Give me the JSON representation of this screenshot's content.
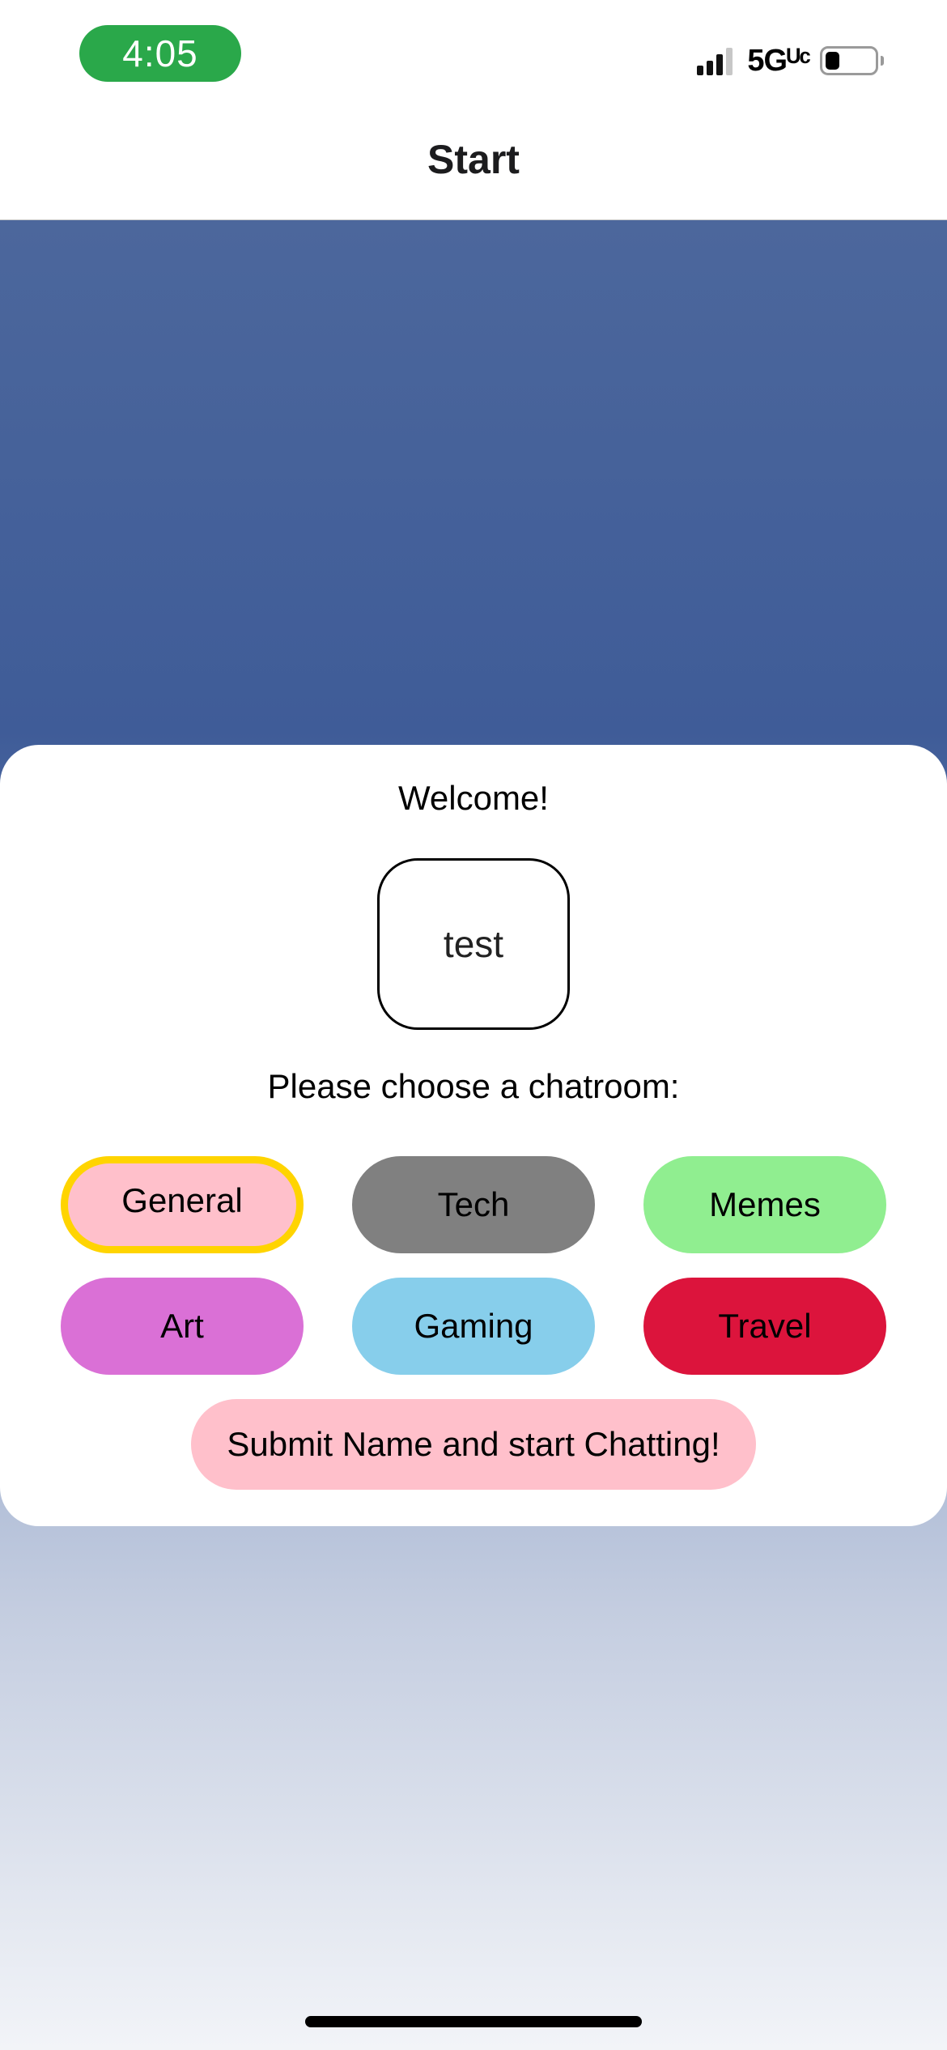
{
  "status_bar": {
    "time": "4:05",
    "time_pill_color": "#2aa84a",
    "network": "5Gᵁᶜ",
    "signal_icon": "cellular-signal-icon",
    "battery_icon": "battery-icon",
    "battery_level": 0.3
  },
  "header": {
    "title": "Start"
  },
  "card": {
    "welcome": "Welcome!",
    "name_input_value": "test",
    "prompt": "Please choose a chatroom:",
    "rooms": [
      {
        "label": "General",
        "color": "#ffc0cb",
        "selected": true
      },
      {
        "label": "Tech",
        "color": "#808080",
        "selected": false
      },
      {
        "label": "Memes",
        "color": "#90ee90",
        "selected": false
      },
      {
        "label": "Art",
        "color": "#da70d6",
        "selected": false
      },
      {
        "label": "Gaming",
        "color": "#87ceeb",
        "selected": false
      },
      {
        "label": "Travel",
        "color": "#dc143c",
        "selected": false
      }
    ],
    "selected_border_color": "#ffd400",
    "submit_label": "Submit Name and start Chatting!",
    "submit_color": "#ffc0cb"
  },
  "home_indicator_icon": "home-indicator"
}
